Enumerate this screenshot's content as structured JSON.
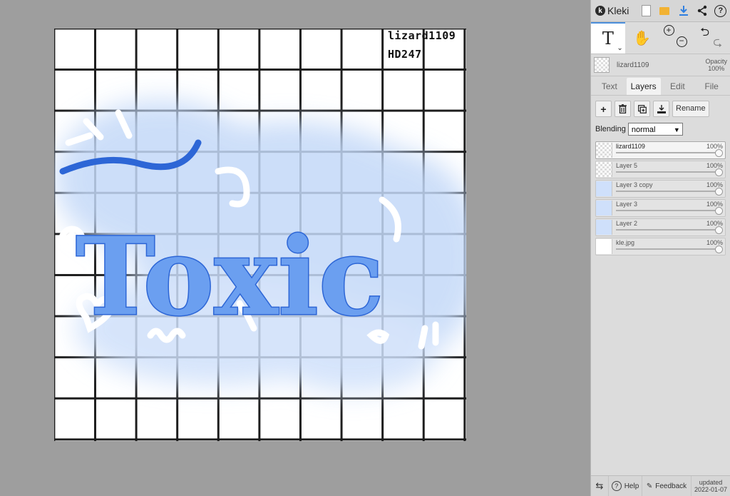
{
  "canvas": {
    "label_line1": "lizard1109",
    "label_line2": "HD247",
    "artwork_text": "Toxic"
  },
  "panel": {
    "app_name": "Kleki",
    "toolbar_icons": [
      "new-image-icon",
      "open-folder-icon",
      "download-icon",
      "share-icon",
      "help-icon"
    ],
    "tools": {
      "text_tool_glyph": "T",
      "hand_tool": "hand-icon",
      "zoom": [
        "zoom-in-icon",
        "zoom-out-icon"
      ],
      "history": [
        "undo-icon",
        "redo-icon"
      ]
    },
    "current_layer": {
      "name": "lizard1109",
      "opacity_label": "Opacity",
      "opacity_value": "100%"
    },
    "tabs": [
      {
        "label": "Text",
        "active": false
      },
      {
        "label": "Layers",
        "active": true
      },
      {
        "label": "Edit",
        "active": false
      },
      {
        "label": "File",
        "active": false
      }
    ],
    "layer_actions": {
      "add": "+",
      "delete": "trash-icon",
      "duplicate": "duplicate-icon",
      "merge": "merge-down-icon",
      "rename_label": "Rename"
    },
    "blending": {
      "label": "Blending",
      "value": "normal"
    },
    "layers": [
      {
        "name": "lizard1109",
        "opacity": "100%",
        "selected": true
      },
      {
        "name": "Layer 5",
        "opacity": "100%",
        "selected": false
      },
      {
        "name": "Layer 3 copy",
        "opacity": "100%",
        "selected": false
      },
      {
        "name": "Layer 3",
        "opacity": "100%",
        "selected": false
      },
      {
        "name": "Layer 2",
        "opacity": "100%",
        "selected": false
      },
      {
        "name": "kle.jpg",
        "opacity": "100%",
        "selected": false
      }
    ],
    "footer": {
      "help_label": "Help",
      "feedback_label": "Feedback",
      "updated_label": "updated",
      "updated_date": "2022-01-07"
    }
  }
}
